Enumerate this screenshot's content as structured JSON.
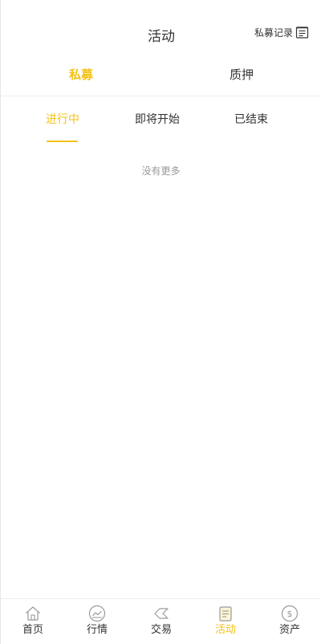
{
  "header": {
    "title": "活动",
    "record_label": "私募记录",
    "record_icon": "list-document-icon"
  },
  "main_tabs": [
    {
      "label": "私募",
      "active": true
    },
    {
      "label": "质押",
      "active": false
    }
  ],
  "sub_tabs": [
    {
      "label": "进行中",
      "active": true
    },
    {
      "label": "即将开始",
      "active": false
    },
    {
      "label": "已结束",
      "active": false
    }
  ],
  "empty_text": "没有更多",
  "tab_bar": [
    {
      "label": "首页",
      "icon": "home-icon",
      "active": false
    },
    {
      "label": "行情",
      "icon": "market-chart-icon",
      "active": false
    },
    {
      "label": "交易",
      "icon": "trade-icon",
      "active": false
    },
    {
      "label": "活动",
      "icon": "activity-document-icon",
      "active": true
    },
    {
      "label": "资产",
      "icon": "dollar-coin-icon",
      "active": false
    }
  ],
  "colors": {
    "accent": "#f5c217",
    "text": "#333333",
    "muted": "#999999",
    "icon_inactive": "#9a9a9a"
  }
}
